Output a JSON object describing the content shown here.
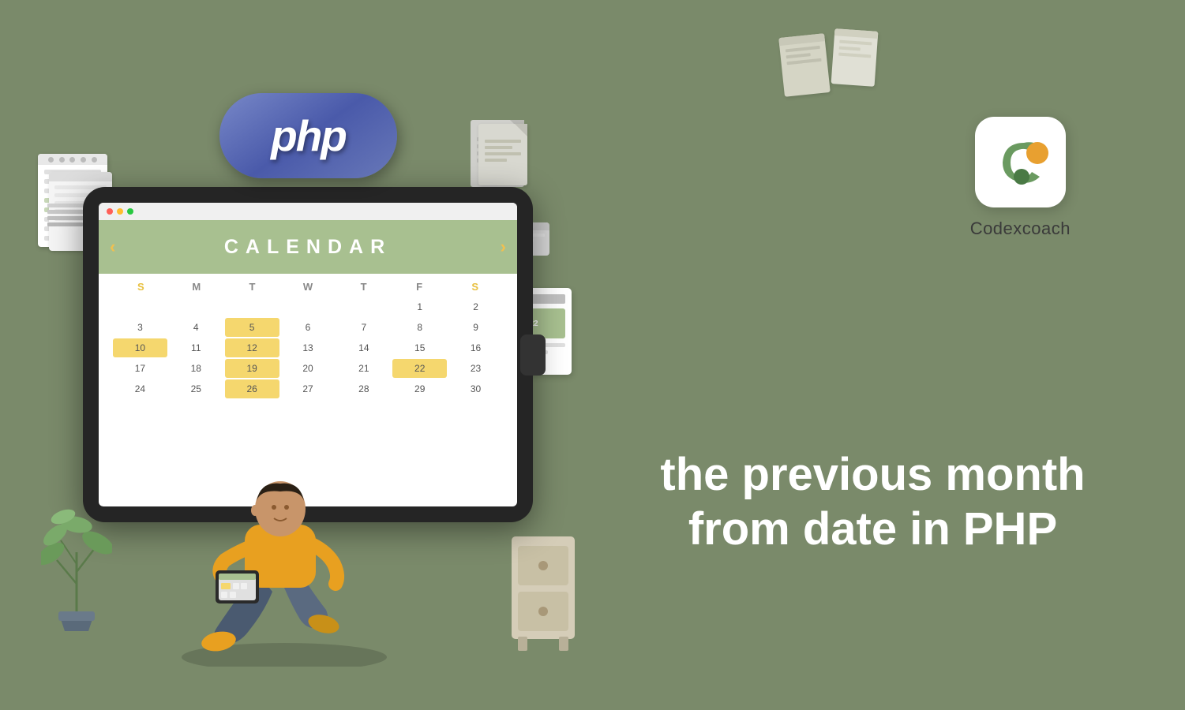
{
  "background_color": "#7a8a6a",
  "php_logo": {
    "text": "php",
    "color": "#6e7eb8"
  },
  "calendar": {
    "title": "CALENDAR",
    "nav_left": "‹",
    "nav_right": "›",
    "day_names": [
      "S",
      "M",
      "T",
      "W",
      "T",
      "F",
      "S"
    ],
    "rows": [
      [
        "",
        "",
        "",
        "",
        "",
        "1",
        "2",
        "3",
        "4"
      ],
      [
        "5",
        "6",
        "7",
        "8",
        "9",
        "10",
        "11"
      ],
      [
        "12",
        "13",
        "14",
        "15",
        "16",
        "17",
        "18"
      ],
      [
        "19",
        "20",
        "21",
        "22",
        "23",
        "24",
        "25"
      ],
      [
        "26",
        "27",
        "28",
        "29",
        "30",
        "",
        ""
      ]
    ],
    "highlight_yellow": [
      "5",
      "12",
      "19",
      "26",
      "10",
      "22"
    ],
    "highlight_green": [],
    "highlight_orange": [
      "22"
    ]
  },
  "codexcoach": {
    "name": "Codexcoach"
  },
  "heading": {
    "line1": "the previous month",
    "line2": "from date in PHP"
  }
}
